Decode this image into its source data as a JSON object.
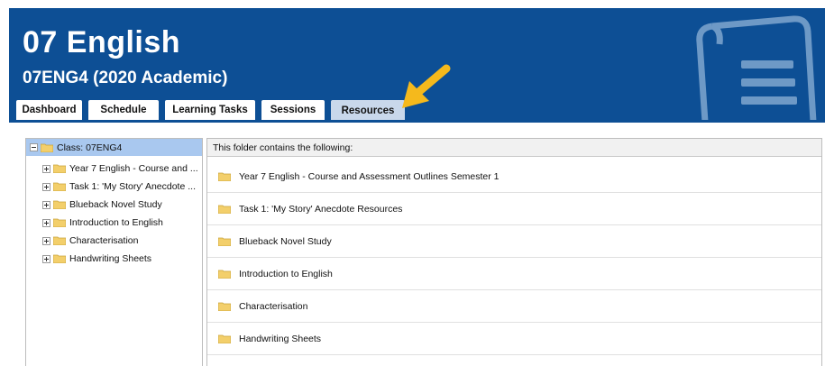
{
  "header": {
    "title": "07 English",
    "subtitle": "07ENG4 (2020 Academic)",
    "background_color": "#0d4f95"
  },
  "tabs": [
    {
      "label": "Dashboard",
      "active": false
    },
    {
      "label": "Schedule",
      "active": false
    },
    {
      "label": "Learning Tasks",
      "active": false
    },
    {
      "label": "Sessions",
      "active": false
    },
    {
      "label": "Resources",
      "active": true
    }
  ],
  "tree": {
    "root_label": "Class: 07ENG4",
    "items": [
      "Year 7 English - Course and ...",
      "Task 1: 'My Story' Anecdote ...",
      "Blueback Novel Study",
      "Introduction to English",
      "Characterisation",
      "Handwriting Sheets"
    ]
  },
  "folder_view": {
    "heading": "This folder contains the following:",
    "items": [
      "Year 7 English - Course and Assessment Outlines Semester 1",
      "Task 1: 'My Story' Anecdote Resources",
      "Blueback Novel Study",
      "Introduction to English",
      "Characterisation",
      "Handwriting Sheets"
    ]
  },
  "colors": {
    "arrow": "#f5b91c",
    "selected_row": "#a9c8ef",
    "folder": "#f3cf6b"
  }
}
